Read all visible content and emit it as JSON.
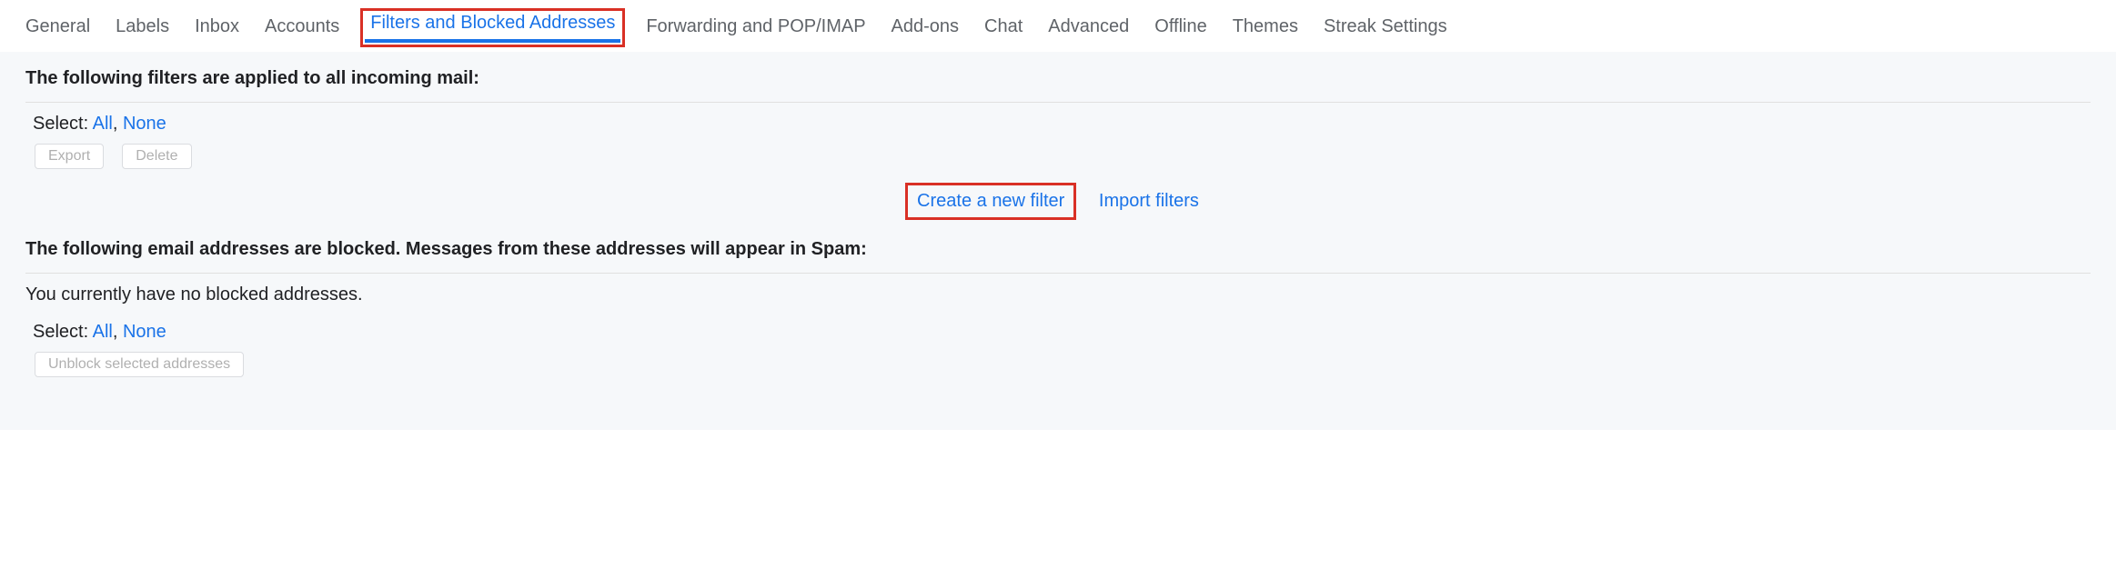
{
  "tabs": {
    "general": "General",
    "labels": "Labels",
    "inbox": "Inbox",
    "accounts": "Accounts",
    "filters": "Filters and Blocked Addresses",
    "forwarding": "Forwarding and POP/IMAP",
    "addons": "Add-ons",
    "chat": "Chat",
    "advanced": "Advanced",
    "offline": "Offline",
    "themes": "Themes",
    "streak": "Streak Settings"
  },
  "filters": {
    "heading": "The following filters are applied to all incoming mail:",
    "select_label": "Select: ",
    "select_all": "All",
    "select_sep": ", ",
    "select_none": "None",
    "export_btn": "Export",
    "delete_btn": "Delete",
    "create_link": "Create a new filter",
    "import_link": "Import filters"
  },
  "blocked": {
    "heading": "The following email addresses are blocked. Messages from these addresses will appear in Spam:",
    "empty_msg": "You currently have no blocked addresses.",
    "select_label": "Select: ",
    "select_all": "All",
    "select_sep": ", ",
    "select_none": "None",
    "unblock_btn": "Unblock selected addresses"
  }
}
